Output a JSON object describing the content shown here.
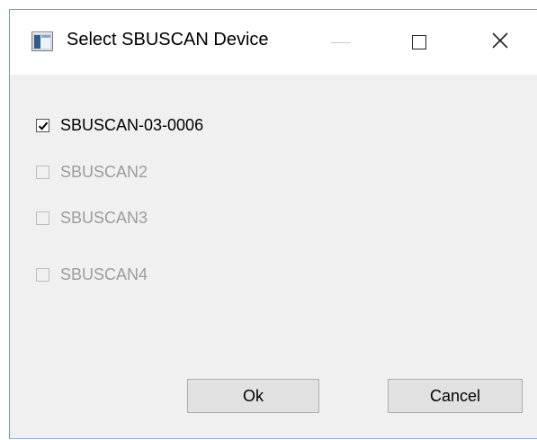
{
  "window": {
    "title": "Select SBUSCAN Device",
    "icon": "app-window-icon",
    "controls": {
      "minimize_icon": "minimize-icon",
      "maximize_icon": "maximize-icon",
      "close_icon": "close-icon",
      "close_glyph": "✕"
    }
  },
  "devices": [
    {
      "label": "SBUSCAN-03-0006",
      "checked": true,
      "enabled": true
    },
    {
      "label": "SBUSCAN2",
      "checked": false,
      "enabled": false
    },
    {
      "label": "SBUSCAN3",
      "checked": false,
      "enabled": false
    },
    {
      "label": "SBUSCAN4",
      "checked": false,
      "enabled": false
    }
  ],
  "buttons": {
    "ok_label": "Ok",
    "cancel_label": "Cancel"
  },
  "colors": {
    "dialog_background": "#f0f0f0",
    "titlebar_background": "#ffffff",
    "disabled_text": "#9c9c9c",
    "button_face": "#e1e1e1",
    "window_border": "#6a9ccf"
  }
}
